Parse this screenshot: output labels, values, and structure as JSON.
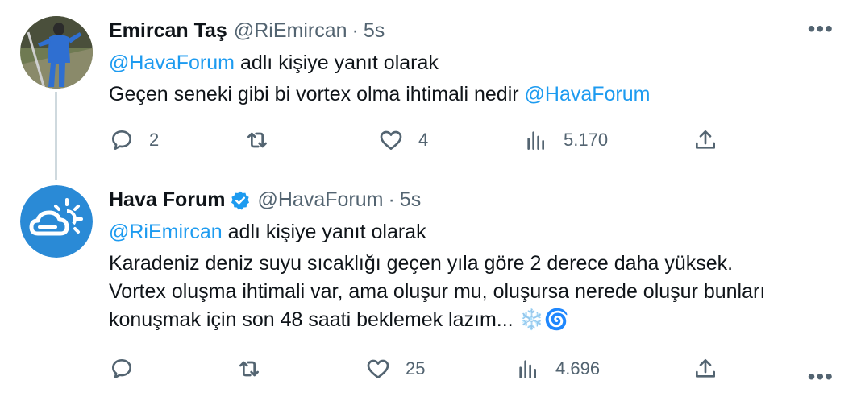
{
  "tweets": [
    {
      "author_name": "Emircan Taş",
      "handle": "@RiEmircan",
      "dot": "·",
      "time": "5s",
      "more": "•••",
      "reply_mention": "@HavaForum",
      "reply_suffix": "adlı kişiye yanıt olarak",
      "body_text": "Geçen seneki gibi bi vortex olma ihtimali nedir ",
      "body_mention": "@HavaForum",
      "replies": "2",
      "retweets": "",
      "likes": "4",
      "views": "5.170",
      "avatar_icon": "person-photo-icon"
    },
    {
      "author_name": "Hava Forum",
      "handle": "@HavaForum",
      "dot": "·",
      "time": "5s",
      "more": "•••",
      "verified_icon": "verified-badge-icon",
      "reply_mention": "@RiEmircan",
      "reply_suffix": "adlı kişiye yanıt olarak",
      "body_line1": "Karadeniz deniz suyu sıcaklığı geçen yıla göre 2 derece daha yüksek.",
      "body_line2": "Vortex oluşma ihtimali var, ama oluşur mu, oluşursa nerede oluşur bunları",
      "body_line3": "konuşmak için son 48 saati beklemek lazım... ",
      "emoji_snow": "❄️",
      "emoji_cyclone": "🌀",
      "replies": "",
      "retweets": "",
      "likes": "25",
      "views": "4.696",
      "avatar_icon": "cloud-sun-logo-icon"
    }
  ],
  "colors": {
    "link": "#1d9bf0",
    "muted": "#536471",
    "text": "#0f1419",
    "verified": "#1d9bf0",
    "avatar2_bg": "#2a8ad6"
  }
}
